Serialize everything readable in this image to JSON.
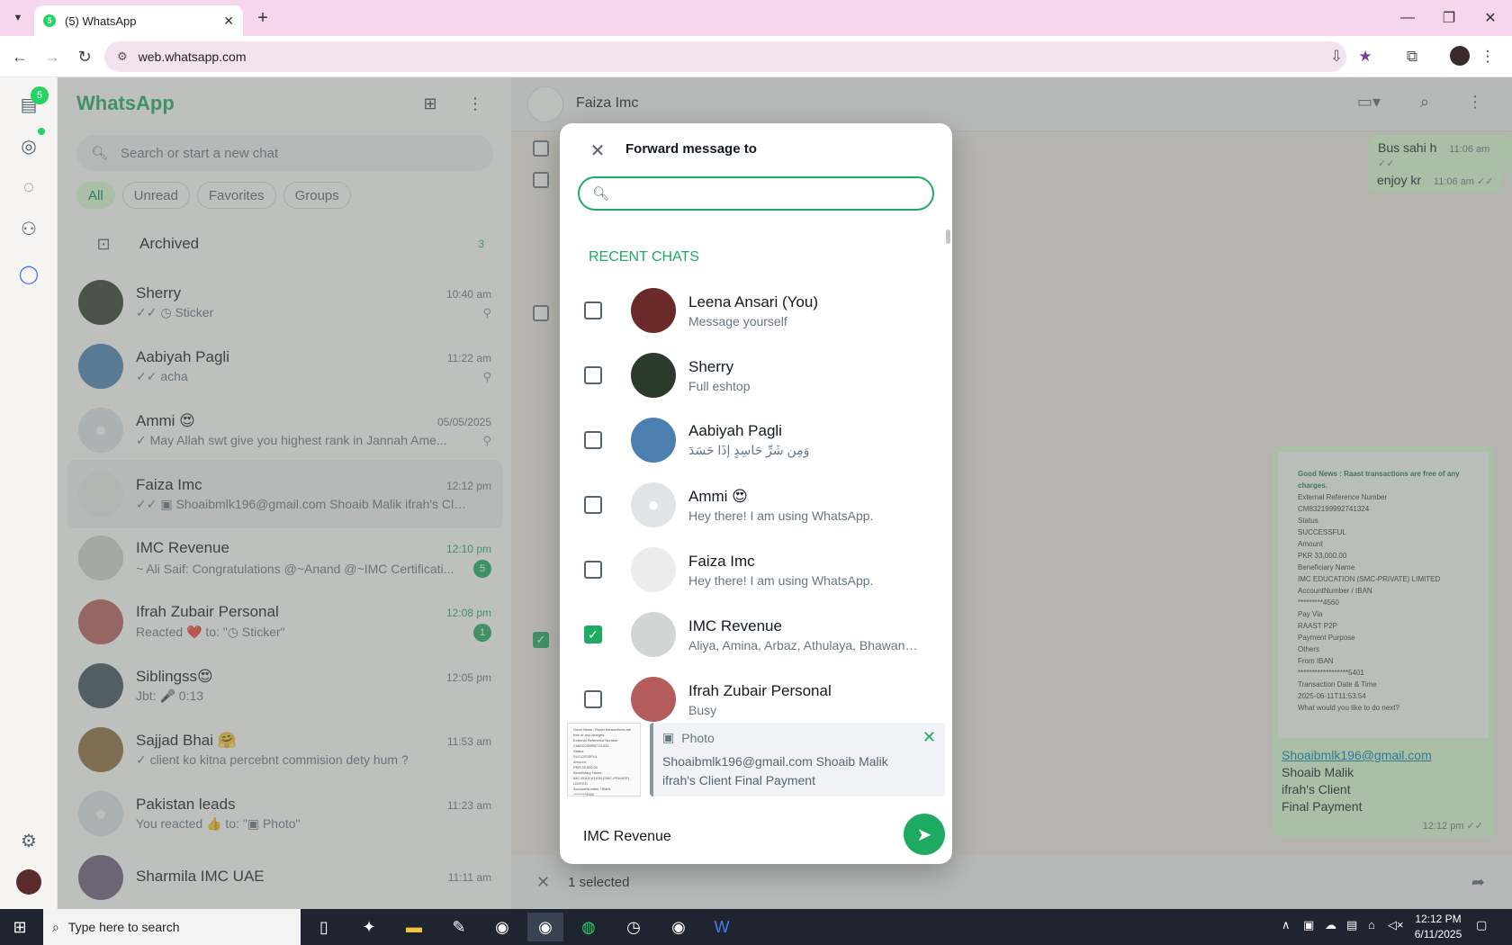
{
  "browser": {
    "tab_title": "(5) WhatsApp",
    "favicon_badge": "5",
    "url": "web.whatsapp.com"
  },
  "rail": {
    "badge": "5"
  },
  "sidebar": {
    "brand": "WhatsApp",
    "search_placeholder": "Search or start a new chat",
    "filters": [
      "All",
      "Unread",
      "Favorites",
      "Groups"
    ],
    "archived_label": "Archived",
    "archived_count": "3",
    "chats": [
      {
        "name": "Sherry",
        "time": "10:40 am",
        "msg": "✓✓ ◷ Sticker",
        "pinned": true,
        "unread": "",
        "color": "#2b3a2a"
      },
      {
        "name": "Aabiyah Pagli",
        "time": "11:22 am",
        "msg": "✓✓ acha",
        "pinned": true,
        "unread": "",
        "color": "#4a7fb0"
      },
      {
        "name": "Ammi 😍",
        "time": "05/05/2025",
        "msg": "✓ May Allah swt give you highest rank in Jannah  Ame...",
        "pinned": true,
        "unread": "",
        "color": "#dfe5e7"
      },
      {
        "name": "Faiza Imc",
        "time": "12:12 pm",
        "msg": "✓✓ ▣ Shoaibmlk196@gmail.com Shoaib Malik  ifrah's Clie...",
        "pinned": false,
        "unread": "",
        "color": "#ececec"
      },
      {
        "name": "IMC Revenue",
        "time": "12:10 pm",
        "msg": "~ Ali Saif: Congratulations @~Anand @~IMC Certificati...",
        "pinned": false,
        "unread": "5",
        "color": "#cfd6d4"
      },
      {
        "name": "Ifrah Zubair Personal",
        "time": "12:08 pm",
        "msg": "Reacted ❤️ to: \"◷ Sticker\"",
        "pinned": false,
        "unread": "1",
        "color": "#b45b5b"
      },
      {
        "name": "Siblingss😍",
        "time": "12:05 pm",
        "msg": "Jbt: 🎤 0:13",
        "pinned": false,
        "unread": "",
        "color": "#3d4b5c"
      },
      {
        "name": "Sajjad Bhai 🤗",
        "time": "11:53 am",
        "msg": "✓ client ko kitna percebnt commision dety hum ?",
        "pinned": false,
        "unread": "",
        "color": "#8a6a3a"
      },
      {
        "name": "Pakistan leads",
        "time": "11:23 am",
        "msg": "You reacted 👍 to: \"▣ Photo\"",
        "pinned": false,
        "unread": "",
        "color": "#dfe5e7"
      },
      {
        "name": "Sharmila IMC UAE",
        "time": "11:11 am",
        "msg": "",
        "pinned": false,
        "unread": "",
        "color": "#6a5a7a"
      }
    ]
  },
  "conversation": {
    "contact_name": "Faiza Imc",
    "messages": [
      {
        "text": "Bus sahi h",
        "time": "11:06 am ✓✓"
      },
      {
        "text": "enjoy kr",
        "time": "11:06 am ✓✓"
      }
    ],
    "receipt_lines": [
      "Good News : Raast transactions are free of any charges.",
      "External Reference Number",
      "CM832199992741324",
      "Status",
      "SUCCESSFUL",
      "Amount",
      "PKR 33,000.00",
      "Beneficiary Name",
      "IMC EDUCATION (SMC-PRIVATE) LIMITED",
      "AccountNumber / IBAN",
      "*********4560",
      "Pay Via",
      "RAAST P2P",
      "Payment Purpose",
      "Others",
      "From IBAN",
      "******************5401",
      "Transaction Date & Time",
      "2025-06-11T11:53:54",
      "What would you like to do next?"
    ],
    "caption_link": "Shoaibmlk196@gmail.com",
    "caption_lines": [
      "Shoaib Malik",
      "ifrah's Client",
      "Final Payment"
    ],
    "caption_time": "12:12 pm ✓✓",
    "selected_text": "1 selected"
  },
  "dialog": {
    "title": "Forward message to",
    "search_value": "",
    "section_label": "RECENT CHATS",
    "contacts": [
      {
        "name": "Leena Ansari (You)",
        "sub": "Message yourself",
        "checked": false,
        "color": "#6b2a2a"
      },
      {
        "name": "Sherry",
        "sub": "Full eshtop",
        "checked": false,
        "color": "#2b3a2a"
      },
      {
        "name": "Aabiyah Pagli",
        "sub": "وَمِن شَرِّ حَاسِدٍ إِذَا حَسَدَ",
        "checked": false,
        "color": "#4a7fb0"
      },
      {
        "name": "Ammi 😍",
        "sub": "Hey there! I am using WhatsApp.",
        "checked": false,
        "color": "#dfe5e7"
      },
      {
        "name": "Faiza Imc",
        "sub": "Hey there! I am using WhatsApp.",
        "checked": false,
        "color": "#ececec"
      },
      {
        "name": "IMC Revenue",
        "sub": "Aliya, Amina, Arbaz, Athulaya, Bhawani,...",
        "checked": true,
        "color": "#cfd6d4"
      },
      {
        "name": "Ifrah Zubair Personal",
        "sub": "Busy",
        "checked": false,
        "color": "#b45b5b"
      }
    ],
    "preview_type": "Photo",
    "preview_text_1": "Shoaibmlk196@gmail.com Shoaib Malik",
    "preview_text_2": "ifrah's Client Final Payment",
    "recipients": "IMC Revenue"
  },
  "taskbar": {
    "search_placeholder": "Type here to search",
    "time": "12:12 PM",
    "date": "6/11/2025"
  }
}
